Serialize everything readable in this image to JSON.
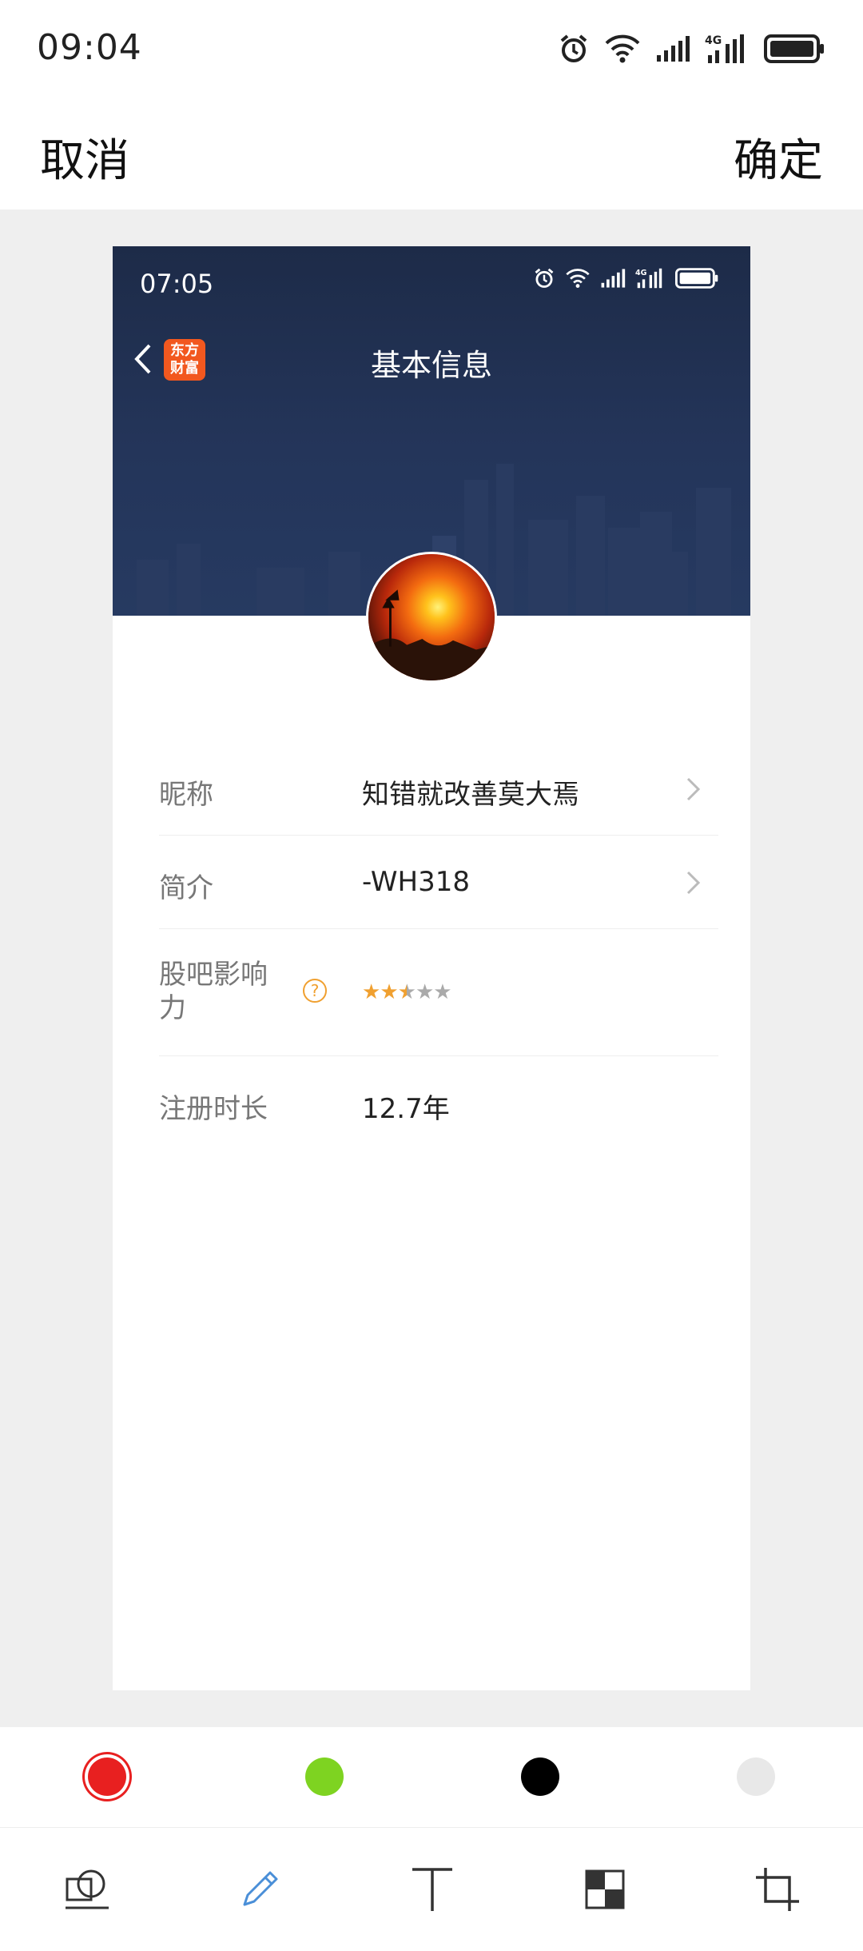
{
  "status_bar": {
    "time": "09:04",
    "icons": [
      "alarm-icon",
      "wifi-icon",
      "signal-icon",
      "4g-signal-icon",
      "battery-icon"
    ]
  },
  "editor": {
    "cancel_label": "取消",
    "confirm_label": "确定"
  },
  "screenshot": {
    "status_time": "07:05",
    "logo_text": "东方财富",
    "nav_title": "基本信息",
    "rows": [
      {
        "label": "昵称",
        "value": "知错就改善莫大焉"
      },
      {
        "label": "简介",
        "value": "-WH318"
      },
      {
        "label": "股吧影响力",
        "value": "",
        "rating": 2.5,
        "rating_max": 5
      },
      {
        "label": "注册时长",
        "value": "12.7年"
      }
    ]
  },
  "palette": {
    "colors": [
      "#e82020",
      "#7ed321",
      "#000000",
      "#e8e8e8"
    ],
    "selected": "#e82020"
  },
  "toolbar": {
    "tools": [
      "shape-icon",
      "pencil-icon",
      "text-icon",
      "mosaic-icon",
      "crop-icon"
    ],
    "active": "pencil-icon"
  },
  "colors": {
    "accent_blue": "#4a8fd8",
    "rating_orange": "#f0a030",
    "banner_navy": "#1d2b48"
  }
}
